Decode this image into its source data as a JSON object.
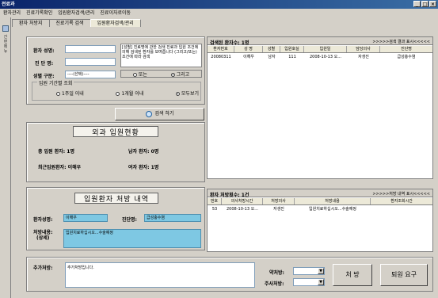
{
  "window": {
    "title": "전료과"
  },
  "menu": [
    "환자관리",
    "진료기록확인",
    "입원환자검색/관리",
    "진료이자로이동"
  ],
  "left_strip": {
    "label": "간편메뉴"
  },
  "tabs": [
    "환자 처방지",
    "진료기록 검색",
    "입원환자검색/관리"
  ],
  "search": {
    "name_label": "환자 성명:",
    "diag_label": "진 단 명:",
    "gender_label": "성별 구분:",
    "gender_value": "----(선택)----",
    "hint": "[성별] 진료명에 관한 검색 진료과 입원 조건에 의해 검색된 환자를 보여줍니다 (그리고/또는) 조건에 따라 검색",
    "or_label": "또는",
    "and_label": "그리고",
    "period_label": "입원 기간별 조회",
    "periods": [
      "1주일 이내",
      "1개월 이내",
      "모두보기"
    ],
    "search_button": "검색 하기"
  },
  "status": {
    "title": "외과 입원현황",
    "total_label": "총 입원 환자:",
    "total_value": "1명",
    "male_label": "남자 환자:",
    "male_value": "0명",
    "latest_label": "최근입원환자:",
    "latest_value": "이해우",
    "female_label": "여자 환자:",
    "female_value": "1명"
  },
  "prescription": {
    "title": "입원환자 처방 내역",
    "patient_label": "환자성명:",
    "patient_value": "이해우",
    "diag_label": "진단명:",
    "diag_value": "급성충수염",
    "content_label": "처방내용:",
    "content_label2": "(상세)",
    "content_value": "입원치료하십시오...수술예정"
  },
  "results": {
    "title": "검색된 환자수: 1명",
    "link": ">>>>>검색 결과 표시<<<<<",
    "columns": [
      "환자번호",
      "성 명",
      "성별",
      "입원호실",
      "입원일",
      "담당의사",
      "진단명"
    ],
    "rows": [
      [
        "20080311",
        "이해우",
        "남자",
        "111",
        "2008-10-13 오...",
        "자생진",
        "급성충수염"
      ]
    ]
  },
  "history": {
    "title": "환자 처방횟수: 1건",
    "link": ">>>>>처방 내역 표시<<<<<",
    "columns": [
      "번호",
      "의사처방시간",
      "처방의사",
      "처방내용",
      "환자조회시간"
    ],
    "rows": [
      [
        "53",
        "2008-10-13 오...",
        "자생진",
        "입원치료하십시오...수술예정",
        ""
      ]
    ]
  },
  "bottom": {
    "extra_label": "추가처방:",
    "extra_value": "추가처방입니다.",
    "drug_label": "약처방:",
    "injection_label": "주사처방:",
    "prescribe_button": "처 방",
    "transfer_button": "퇴원 요구"
  },
  "colors": {
    "highlight": "#7ec8e3",
    "titlebar": "#0a246a",
    "face": "#d4d0c8"
  }
}
